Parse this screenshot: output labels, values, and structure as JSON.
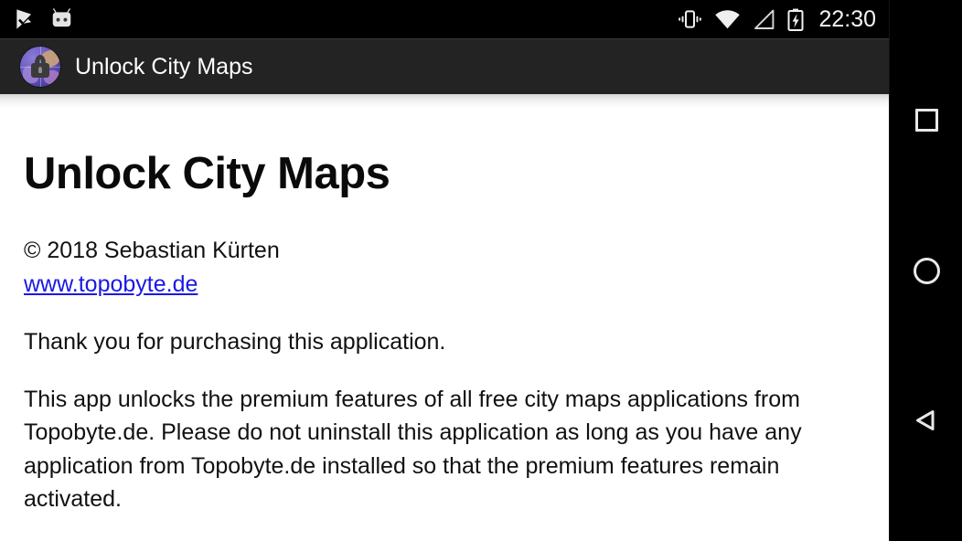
{
  "status_bar": {
    "notifications": [
      {
        "icon": "play-store-update-icon"
      },
      {
        "icon": "android-robot-icon"
      }
    ],
    "system_icons": [
      {
        "icon": "vibrate-icon"
      },
      {
        "icon": "wifi-icon"
      },
      {
        "icon": "cell-signal-empty-icon"
      },
      {
        "icon": "battery-charging-icon"
      }
    ],
    "clock": "22:30",
    "background_color": "#000000"
  },
  "toolbar": {
    "title": "Unlock City Maps",
    "icon": "app-lock-globe-icon",
    "background_color": "#232323",
    "title_color": "#ffffff"
  },
  "content": {
    "page_title": "Unlock City Maps",
    "copyright": "© 2018 Sebastian Kürten",
    "website_link": "www.topobyte.de",
    "link_color": "#1919e6",
    "paragraph_thanks": "Thank you for purchasing this application.",
    "paragraph_details": "This app unlocks the premium features of all free city maps applications from Topobyte.de. Please do not uninstall this application as long as you have any application from Topobyte.de installed so that the premium features remain activated.",
    "background_color": "#ffffff",
    "text_color": "#111111"
  },
  "navigation_bar": {
    "background_color": "#000000",
    "buttons": [
      {
        "name": "recents",
        "icon": "square-icon"
      },
      {
        "name": "home",
        "icon": "circle-icon"
      },
      {
        "name": "back",
        "icon": "triangle-left-icon"
      }
    ]
  }
}
